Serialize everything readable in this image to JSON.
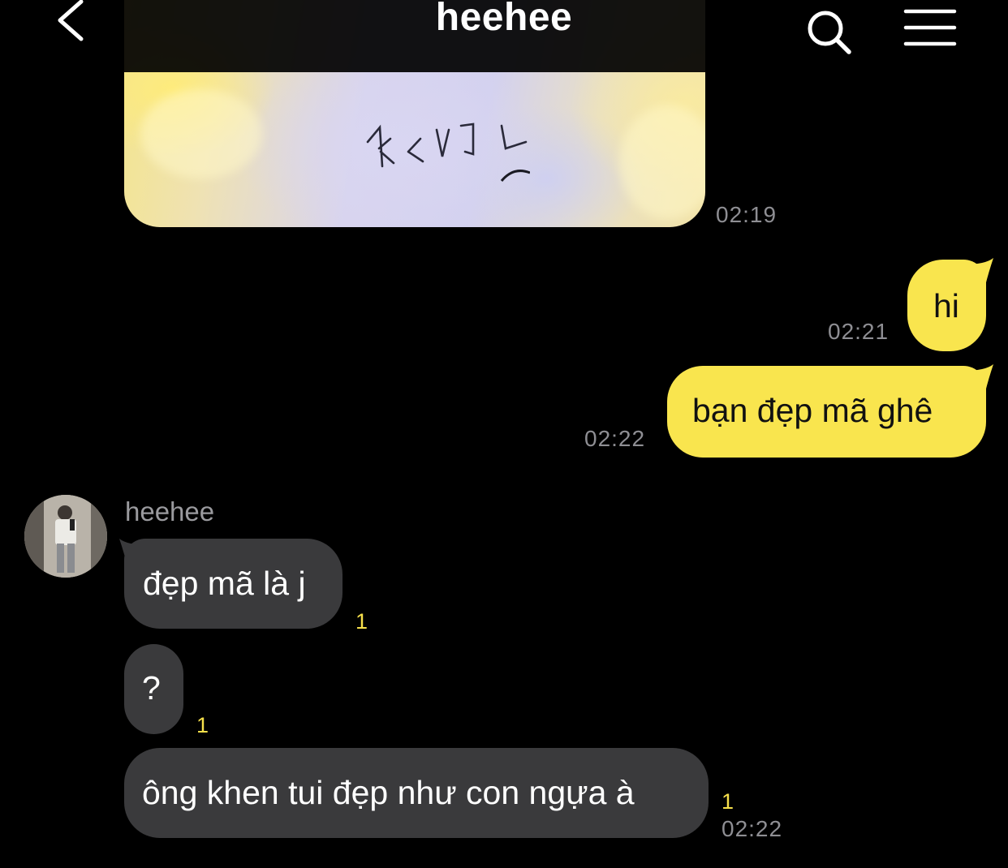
{
  "header": {
    "title": "heehee",
    "back_icon": "chevron-left-icon",
    "search_icon": "search-icon",
    "menu_icon": "hamburger-menu-icon"
  },
  "colors": {
    "background": "#000000",
    "outgoing_bubble": "#f9e54e",
    "incoming_bubble": "#3a3a3c",
    "timestamp": "#8e8e93",
    "unread_count": "#f7e04b"
  },
  "messages": {
    "photo": {
      "time": "02:19"
    },
    "out_hi": {
      "text": "hi",
      "time": "02:21"
    },
    "out_compliment": {
      "text": "bạn đẹp mã ghê",
      "time": "02:22"
    },
    "incoming_group": {
      "sender": "heehee",
      "items": [
        {
          "text": "đẹp mã là j",
          "unread": "1"
        },
        {
          "text": "?",
          "unread": "1"
        },
        {
          "text": "ông khen tui đẹp như con ngựa à",
          "unread": "1",
          "time": "02:22"
        }
      ]
    }
  }
}
